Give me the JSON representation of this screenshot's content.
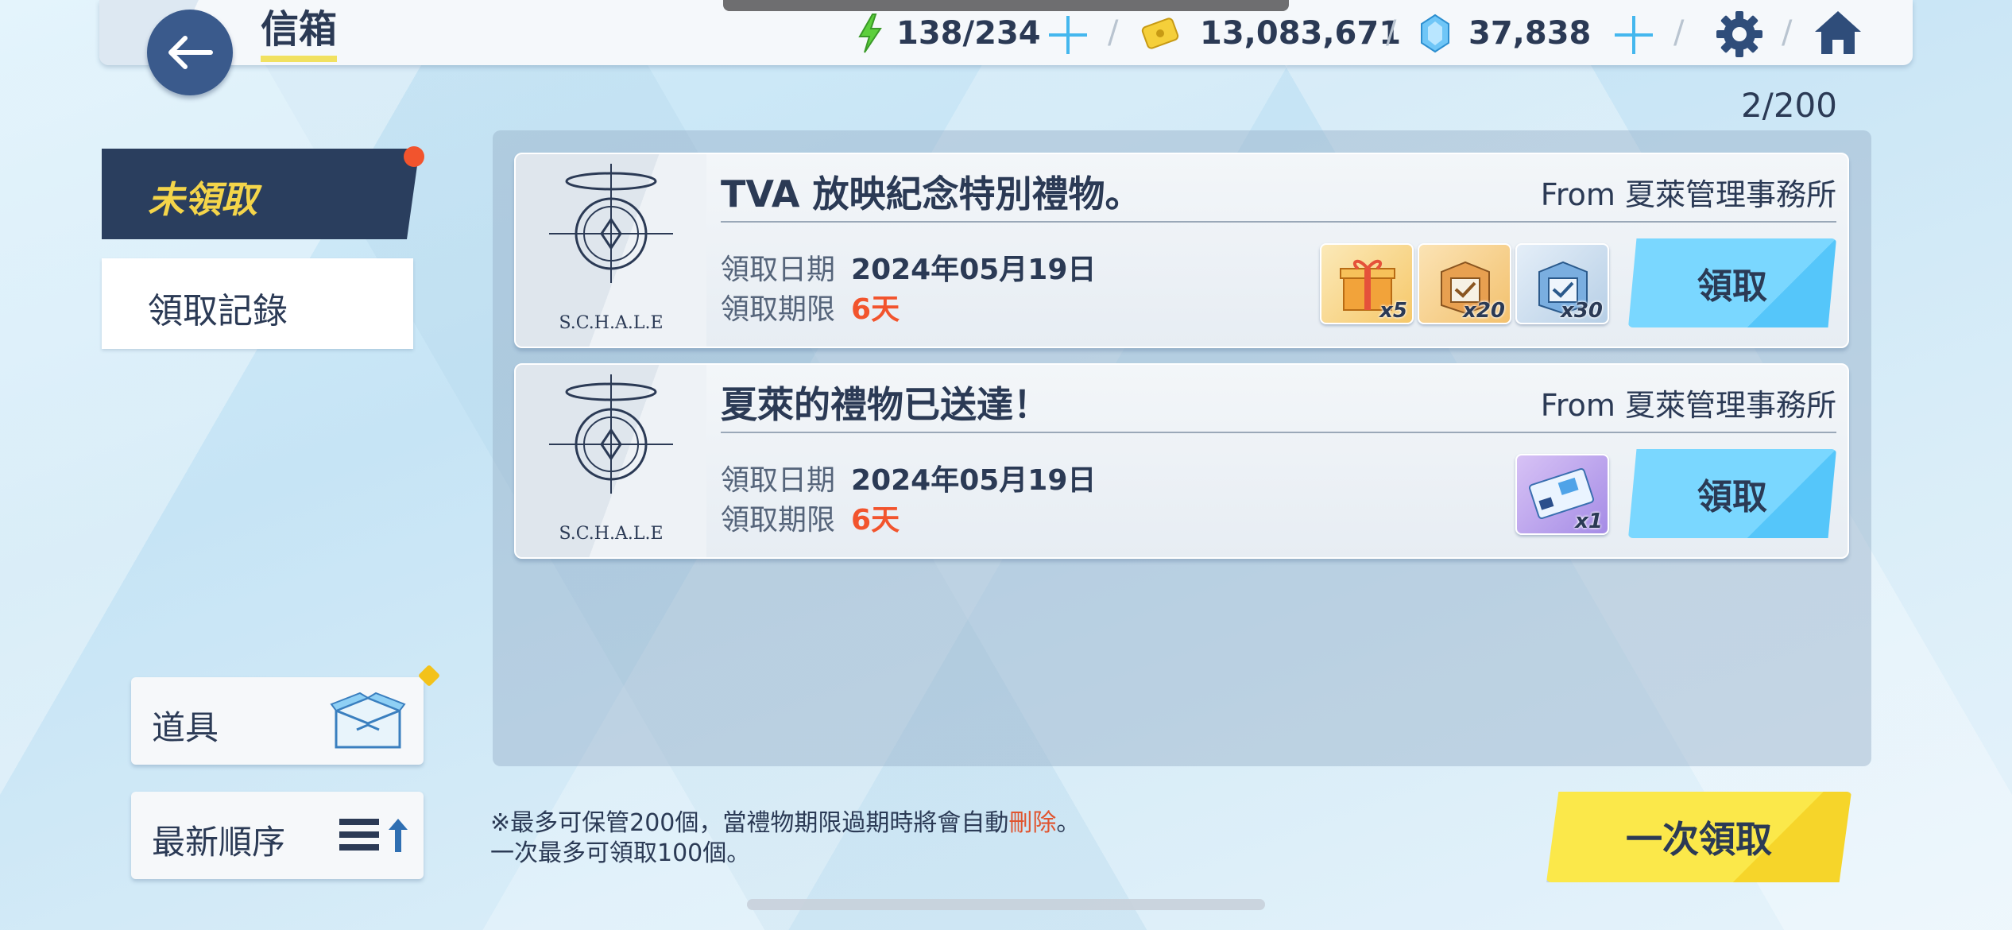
{
  "header": {
    "title": "信箱",
    "stamina": "138/234",
    "credits": "13,083,671",
    "pyroxene": "37,838"
  },
  "tabs": {
    "unclaimed": "未領取",
    "history": "領取記錄"
  },
  "side_buttons": {
    "items": "道具",
    "sort": "最新順序"
  },
  "mail": {
    "count": "2/200",
    "entries": [
      {
        "title": "TVA 放映紀念特別禮物。",
        "from": "From 夏萊管理事務所",
        "date_label": "領取日期",
        "date": "2024年05月19日",
        "expire_label": "領取期限",
        "expire": "6天",
        "logo_text": "S.C.H.A.L.E",
        "rewards": [
          {
            "icon": "gift-box-icon",
            "qty": "x5"
          },
          {
            "icon": "supply-crate-icon",
            "qty": "x20"
          },
          {
            "icon": "blue-crate-icon",
            "qty": "x30"
          }
        ],
        "claim": "領取"
      },
      {
        "title": "夏萊的禮物已送達！",
        "from": "From 夏萊管理事務所",
        "date_label": "領取日期",
        "date": "2024年05月19日",
        "expire_label": "領取期限",
        "expire": "6天",
        "logo_text": "S.C.H.A.L.E",
        "rewards": [
          {
            "icon": "ticket-icon",
            "qty": "x1"
          }
        ],
        "claim": "領取"
      }
    ]
  },
  "footer": {
    "note_line1_a": "※最多可保管200個，當禮物期限過期時將會自動",
    "note_line1_red": "刪除",
    "note_line1_b": "。",
    "note_line2": "一次最多可領取100個。",
    "claim_all": "一次領取"
  },
  "colors": {
    "accent_blue": "#7ad7ff",
    "accent_yellow": "#fbe84a",
    "dark_navy": "#2a3e5e",
    "alert_red": "#f2542d"
  }
}
